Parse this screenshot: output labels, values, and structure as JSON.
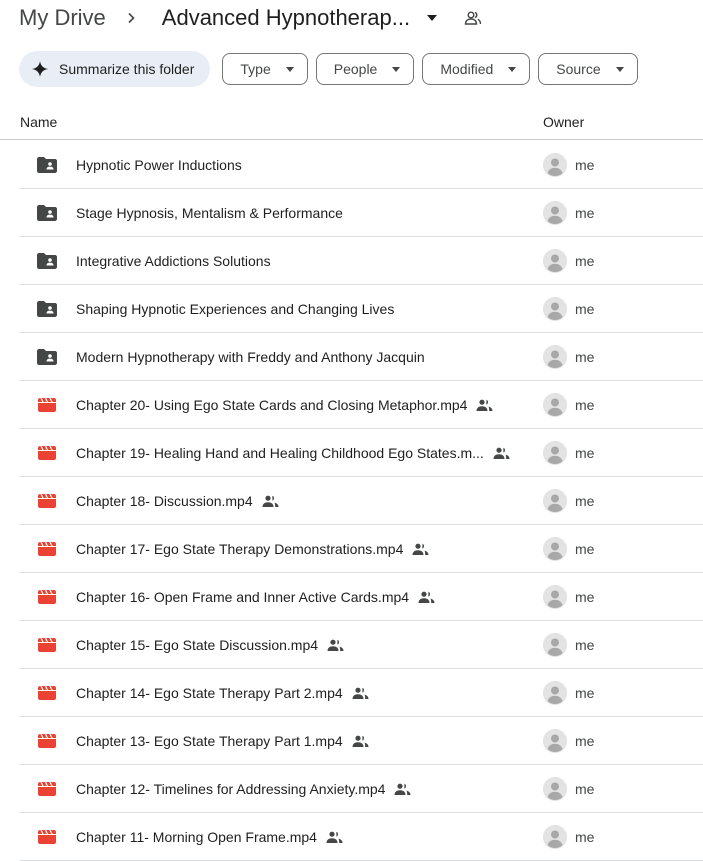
{
  "breadcrumb": {
    "root": "My Drive",
    "current": "Advanced Hypnotherap...",
    "separator_icon": "chevron-right-icon",
    "caret_icon": "caret-down-icon",
    "shared_icon": "shared-folder-icon"
  },
  "toolbar": {
    "summarize_label": "Summarize this folder",
    "filters": [
      {
        "label": "Type"
      },
      {
        "label": "People"
      },
      {
        "label": "Modified"
      },
      {
        "label": "Source"
      }
    ]
  },
  "columns": {
    "name": "Name",
    "owner": "Owner"
  },
  "colors": {
    "folder": "#444746",
    "video": "#ea4335",
    "chip_bg": "#e9eef6",
    "divider": "#dadce0"
  },
  "files": [
    {
      "type": "folder",
      "name": "Hypnotic Power Inductions",
      "owner": "me",
      "shared": false
    },
    {
      "type": "folder",
      "name": "Stage Hypnosis, Mentalism & Performance",
      "owner": "me",
      "shared": false
    },
    {
      "type": "folder",
      "name": "Integrative Addictions Solutions",
      "owner": "me",
      "shared": false
    },
    {
      "type": "folder",
      "name": "Shaping Hypnotic Experiences and Changing Lives",
      "owner": "me",
      "shared": false
    },
    {
      "type": "folder",
      "name": "Modern Hypnotherapy with Freddy and Anthony Jacquin",
      "owner": "me",
      "shared": false
    },
    {
      "type": "video",
      "name": "Chapter 20- Using Ego State Cards and Closing Metaphor.mp4",
      "owner": "me",
      "shared": true
    },
    {
      "type": "video",
      "name": "Chapter 19- Healing Hand and Healing Childhood Ego States.m...",
      "owner": "me",
      "shared": true
    },
    {
      "type": "video",
      "name": "Chapter 18- Discussion.mp4",
      "owner": "me",
      "shared": true
    },
    {
      "type": "video",
      "name": "Chapter 17- Ego State Therapy Demonstrations.mp4",
      "owner": "me",
      "shared": true
    },
    {
      "type": "video",
      "name": "Chapter 16- Open Frame and Inner Active Cards.mp4",
      "owner": "me",
      "shared": true
    },
    {
      "type": "video",
      "name": "Chapter 15- Ego State Discussion.mp4",
      "owner": "me",
      "shared": true
    },
    {
      "type": "video",
      "name": "Chapter 14- Ego State Therapy Part 2.mp4",
      "owner": "me",
      "shared": true
    },
    {
      "type": "video",
      "name": "Chapter 13- Ego State Therapy Part 1.mp4",
      "owner": "me",
      "shared": true
    },
    {
      "type": "video",
      "name": "Chapter 12- Timelines for Addressing Anxiety.mp4",
      "owner": "me",
      "shared": true
    },
    {
      "type": "video",
      "name": "Chapter 11- Morning Open Frame.mp4",
      "owner": "me",
      "shared": true
    }
  ]
}
